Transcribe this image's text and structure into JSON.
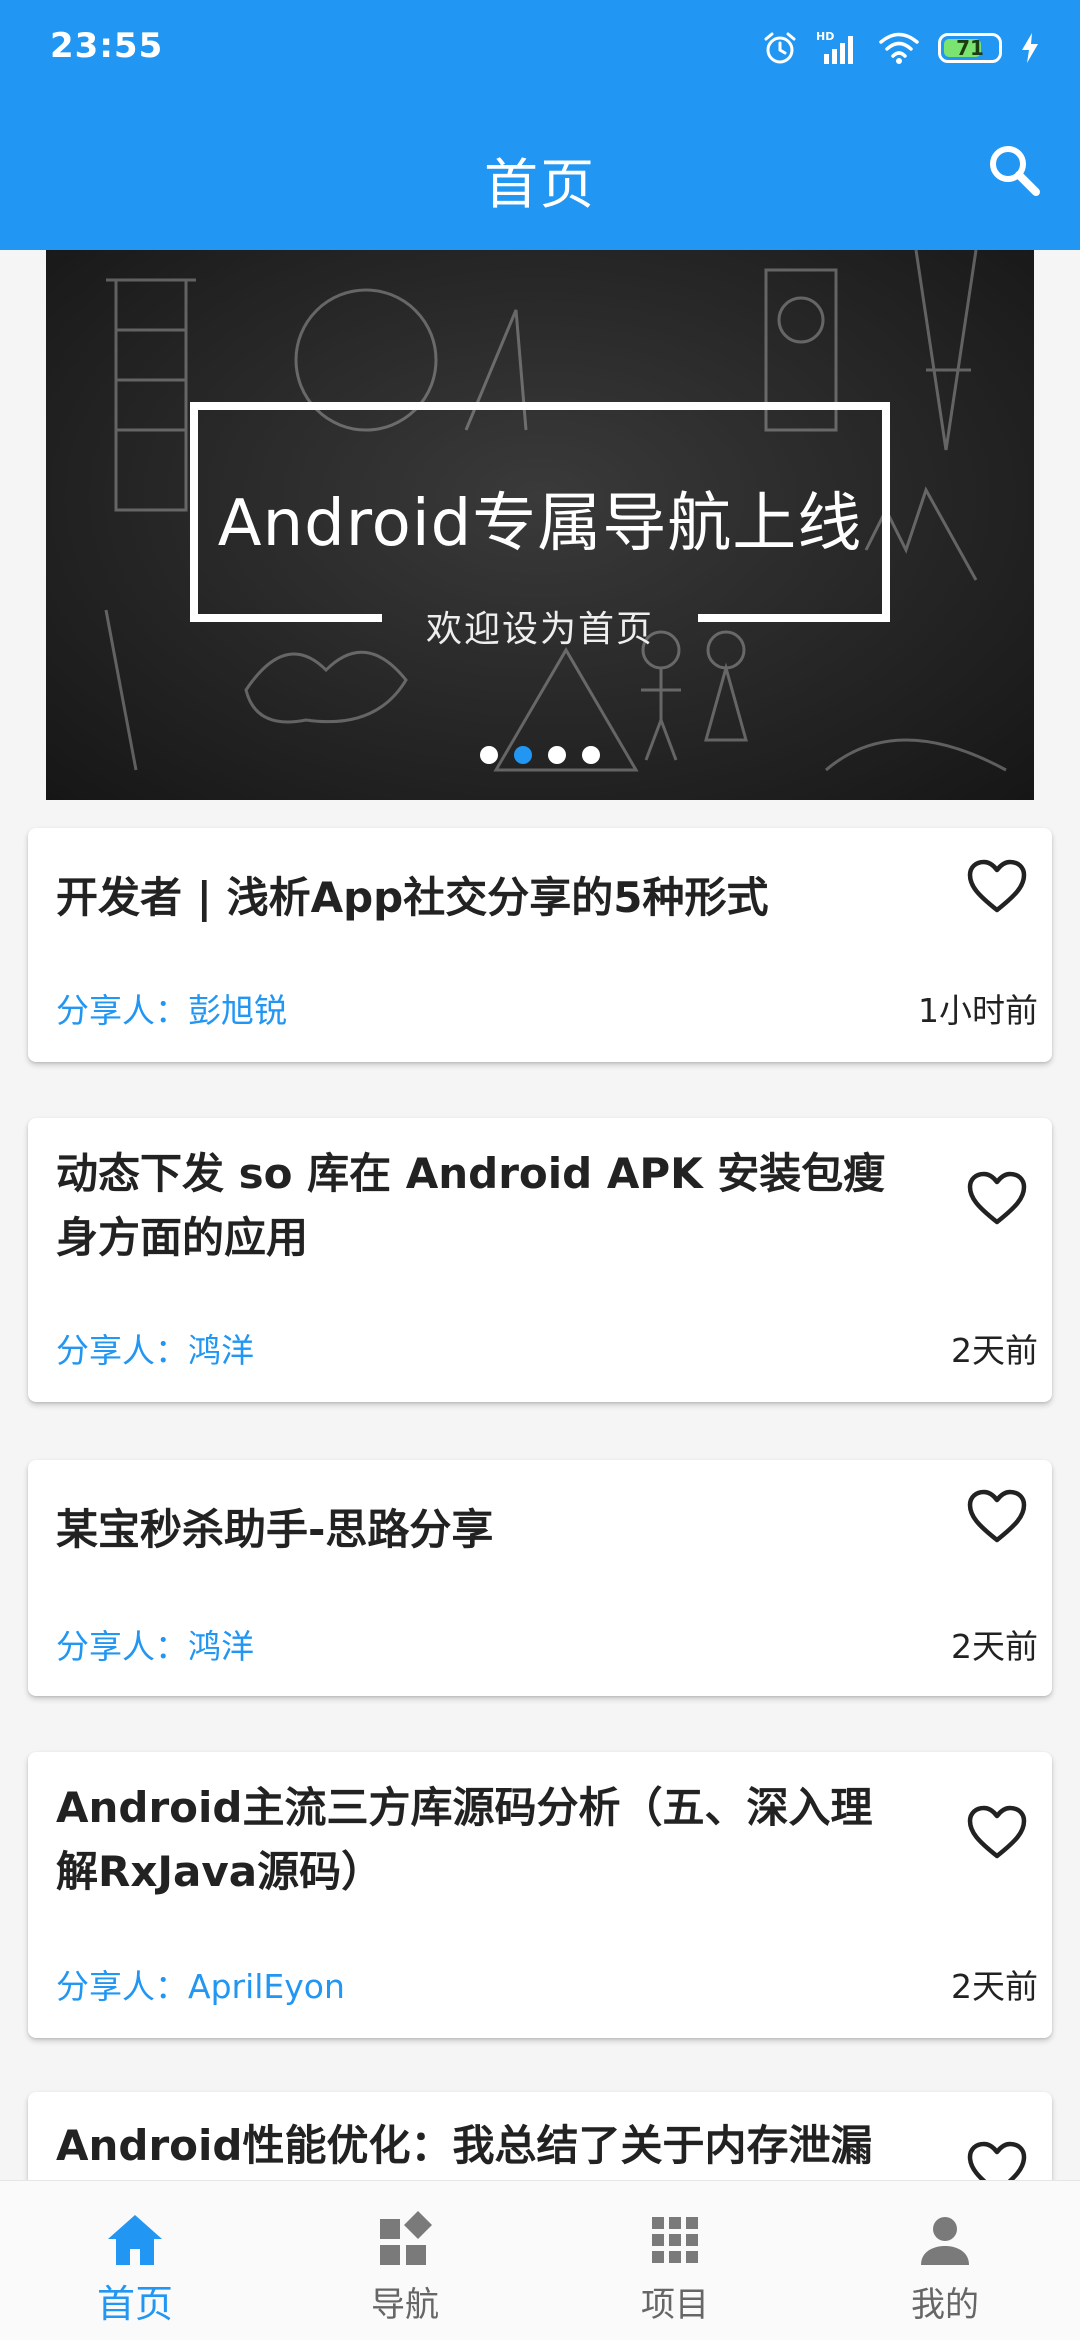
{
  "status_bar": {
    "time": "23:55",
    "battery_percent": "71",
    "icons": [
      "alarm-icon",
      "hd-signal-icon",
      "wifi-icon",
      "battery-icon",
      "charging-icon"
    ]
  },
  "app_bar": {
    "title": "首页",
    "search_icon": "search-icon"
  },
  "banner": {
    "title": "Android专属导航上线",
    "subtitle": "欢迎设为首页",
    "page_count": 4,
    "active_page": 2
  },
  "articles": [
    {
      "title": "开发者 | 浅析App社交分享的5种形式",
      "author": "分享人：彭旭锐",
      "time": "1小时前"
    },
    {
      "title": "动态下发 so 库在 Android APK 安装包瘦身方面的应用",
      "author": "分享人：鸿洋",
      "time": "2天前"
    },
    {
      "title": "某宝秒杀助手-思路分享",
      "author": "分享人：鸿洋",
      "time": "2天前"
    },
    {
      "title": "Android主流三方库源码分析（五、深入理解RxJava源码）",
      "author": "分享人：AprilEyon",
      "time": "2天前"
    },
    {
      "title": "Android性能优化：我总结了关于内存泄漏",
      "author": "",
      "time": ""
    }
  ],
  "bottom_nav": [
    {
      "label": "首页",
      "icon": "home-icon",
      "active": true
    },
    {
      "label": "导航",
      "icon": "widgets-icon",
      "active": false
    },
    {
      "label": "项目",
      "icon": "apps-grid-icon",
      "active": false
    },
    {
      "label": "我的",
      "icon": "person-icon",
      "active": false
    }
  ],
  "colors": {
    "primary": "#2196f3",
    "text": "#222222",
    "background": "#f5f5f5"
  }
}
